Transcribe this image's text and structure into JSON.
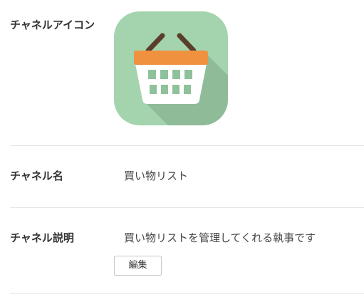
{
  "channel_icon": {
    "label": "チャネルアイコン",
    "icon": "shopping-basket-icon",
    "colors": {
      "background": "#a3d4ae",
      "shadow": "#8fbb99",
      "rim": "#f0913f",
      "handle": "#5a3e2b",
      "basket": "#ffffff",
      "holes": "#8fc19b"
    }
  },
  "channel_name": {
    "label": "チャネル名",
    "value": "買い物リスト"
  },
  "channel_description": {
    "label": "チャネル説明",
    "value": "買い物リストを管理してくれる執事です",
    "edit_label": "編集"
  }
}
